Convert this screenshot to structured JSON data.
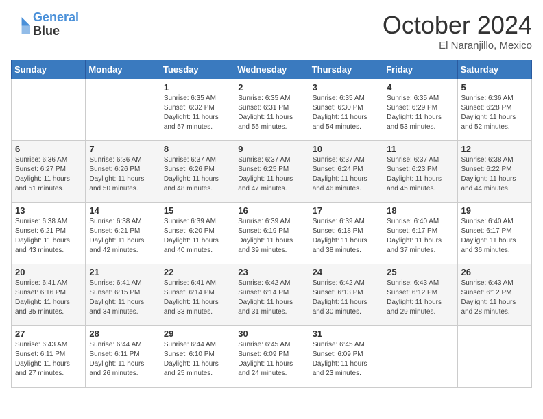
{
  "logo": {
    "line1": "General",
    "line2": "Blue"
  },
  "title": "October 2024",
  "location": "El Naranjillo, Mexico",
  "days_header": [
    "Sunday",
    "Monday",
    "Tuesday",
    "Wednesday",
    "Thursday",
    "Friday",
    "Saturday"
  ],
  "weeks": [
    [
      {
        "day": "",
        "sunrise": "",
        "sunset": "",
        "daylight": ""
      },
      {
        "day": "",
        "sunrise": "",
        "sunset": "",
        "daylight": ""
      },
      {
        "day": "1",
        "sunrise": "Sunrise: 6:35 AM",
        "sunset": "Sunset: 6:32 PM",
        "daylight": "Daylight: 11 hours and 57 minutes."
      },
      {
        "day": "2",
        "sunrise": "Sunrise: 6:35 AM",
        "sunset": "Sunset: 6:31 PM",
        "daylight": "Daylight: 11 hours and 55 minutes."
      },
      {
        "day": "3",
        "sunrise": "Sunrise: 6:35 AM",
        "sunset": "Sunset: 6:30 PM",
        "daylight": "Daylight: 11 hours and 54 minutes."
      },
      {
        "day": "4",
        "sunrise": "Sunrise: 6:35 AM",
        "sunset": "Sunset: 6:29 PM",
        "daylight": "Daylight: 11 hours and 53 minutes."
      },
      {
        "day": "5",
        "sunrise": "Sunrise: 6:36 AM",
        "sunset": "Sunset: 6:28 PM",
        "daylight": "Daylight: 11 hours and 52 minutes."
      }
    ],
    [
      {
        "day": "6",
        "sunrise": "Sunrise: 6:36 AM",
        "sunset": "Sunset: 6:27 PM",
        "daylight": "Daylight: 11 hours and 51 minutes."
      },
      {
        "day": "7",
        "sunrise": "Sunrise: 6:36 AM",
        "sunset": "Sunset: 6:26 PM",
        "daylight": "Daylight: 11 hours and 50 minutes."
      },
      {
        "day": "8",
        "sunrise": "Sunrise: 6:37 AM",
        "sunset": "Sunset: 6:26 PM",
        "daylight": "Daylight: 11 hours and 48 minutes."
      },
      {
        "day": "9",
        "sunrise": "Sunrise: 6:37 AM",
        "sunset": "Sunset: 6:25 PM",
        "daylight": "Daylight: 11 hours and 47 minutes."
      },
      {
        "day": "10",
        "sunrise": "Sunrise: 6:37 AM",
        "sunset": "Sunset: 6:24 PM",
        "daylight": "Daylight: 11 hours and 46 minutes."
      },
      {
        "day": "11",
        "sunrise": "Sunrise: 6:37 AM",
        "sunset": "Sunset: 6:23 PM",
        "daylight": "Daylight: 11 hours and 45 minutes."
      },
      {
        "day": "12",
        "sunrise": "Sunrise: 6:38 AM",
        "sunset": "Sunset: 6:22 PM",
        "daylight": "Daylight: 11 hours and 44 minutes."
      }
    ],
    [
      {
        "day": "13",
        "sunrise": "Sunrise: 6:38 AM",
        "sunset": "Sunset: 6:21 PM",
        "daylight": "Daylight: 11 hours and 43 minutes."
      },
      {
        "day": "14",
        "sunrise": "Sunrise: 6:38 AM",
        "sunset": "Sunset: 6:21 PM",
        "daylight": "Daylight: 11 hours and 42 minutes."
      },
      {
        "day": "15",
        "sunrise": "Sunrise: 6:39 AM",
        "sunset": "Sunset: 6:20 PM",
        "daylight": "Daylight: 11 hours and 40 minutes."
      },
      {
        "day": "16",
        "sunrise": "Sunrise: 6:39 AM",
        "sunset": "Sunset: 6:19 PM",
        "daylight": "Daylight: 11 hours and 39 minutes."
      },
      {
        "day": "17",
        "sunrise": "Sunrise: 6:39 AM",
        "sunset": "Sunset: 6:18 PM",
        "daylight": "Daylight: 11 hours and 38 minutes."
      },
      {
        "day": "18",
        "sunrise": "Sunrise: 6:40 AM",
        "sunset": "Sunset: 6:17 PM",
        "daylight": "Daylight: 11 hours and 37 minutes."
      },
      {
        "day": "19",
        "sunrise": "Sunrise: 6:40 AM",
        "sunset": "Sunset: 6:17 PM",
        "daylight": "Daylight: 11 hours and 36 minutes."
      }
    ],
    [
      {
        "day": "20",
        "sunrise": "Sunrise: 6:41 AM",
        "sunset": "Sunset: 6:16 PM",
        "daylight": "Daylight: 11 hours and 35 minutes."
      },
      {
        "day": "21",
        "sunrise": "Sunrise: 6:41 AM",
        "sunset": "Sunset: 6:15 PM",
        "daylight": "Daylight: 11 hours and 34 minutes."
      },
      {
        "day": "22",
        "sunrise": "Sunrise: 6:41 AM",
        "sunset": "Sunset: 6:14 PM",
        "daylight": "Daylight: 11 hours and 33 minutes."
      },
      {
        "day": "23",
        "sunrise": "Sunrise: 6:42 AM",
        "sunset": "Sunset: 6:14 PM",
        "daylight": "Daylight: 11 hours and 31 minutes."
      },
      {
        "day": "24",
        "sunrise": "Sunrise: 6:42 AM",
        "sunset": "Sunset: 6:13 PM",
        "daylight": "Daylight: 11 hours and 30 minutes."
      },
      {
        "day": "25",
        "sunrise": "Sunrise: 6:43 AM",
        "sunset": "Sunset: 6:12 PM",
        "daylight": "Daylight: 11 hours and 29 minutes."
      },
      {
        "day": "26",
        "sunrise": "Sunrise: 6:43 AM",
        "sunset": "Sunset: 6:12 PM",
        "daylight": "Daylight: 11 hours and 28 minutes."
      }
    ],
    [
      {
        "day": "27",
        "sunrise": "Sunrise: 6:43 AM",
        "sunset": "Sunset: 6:11 PM",
        "daylight": "Daylight: 11 hours and 27 minutes."
      },
      {
        "day": "28",
        "sunrise": "Sunrise: 6:44 AM",
        "sunset": "Sunset: 6:11 PM",
        "daylight": "Daylight: 11 hours and 26 minutes."
      },
      {
        "day": "29",
        "sunrise": "Sunrise: 6:44 AM",
        "sunset": "Sunset: 6:10 PM",
        "daylight": "Daylight: 11 hours and 25 minutes."
      },
      {
        "day": "30",
        "sunrise": "Sunrise: 6:45 AM",
        "sunset": "Sunset: 6:09 PM",
        "daylight": "Daylight: 11 hours and 24 minutes."
      },
      {
        "day": "31",
        "sunrise": "Sunrise: 6:45 AM",
        "sunset": "Sunset: 6:09 PM",
        "daylight": "Daylight: 11 hours and 23 minutes."
      },
      {
        "day": "",
        "sunrise": "",
        "sunset": "",
        "daylight": ""
      },
      {
        "day": "",
        "sunrise": "",
        "sunset": "",
        "daylight": ""
      }
    ]
  ]
}
